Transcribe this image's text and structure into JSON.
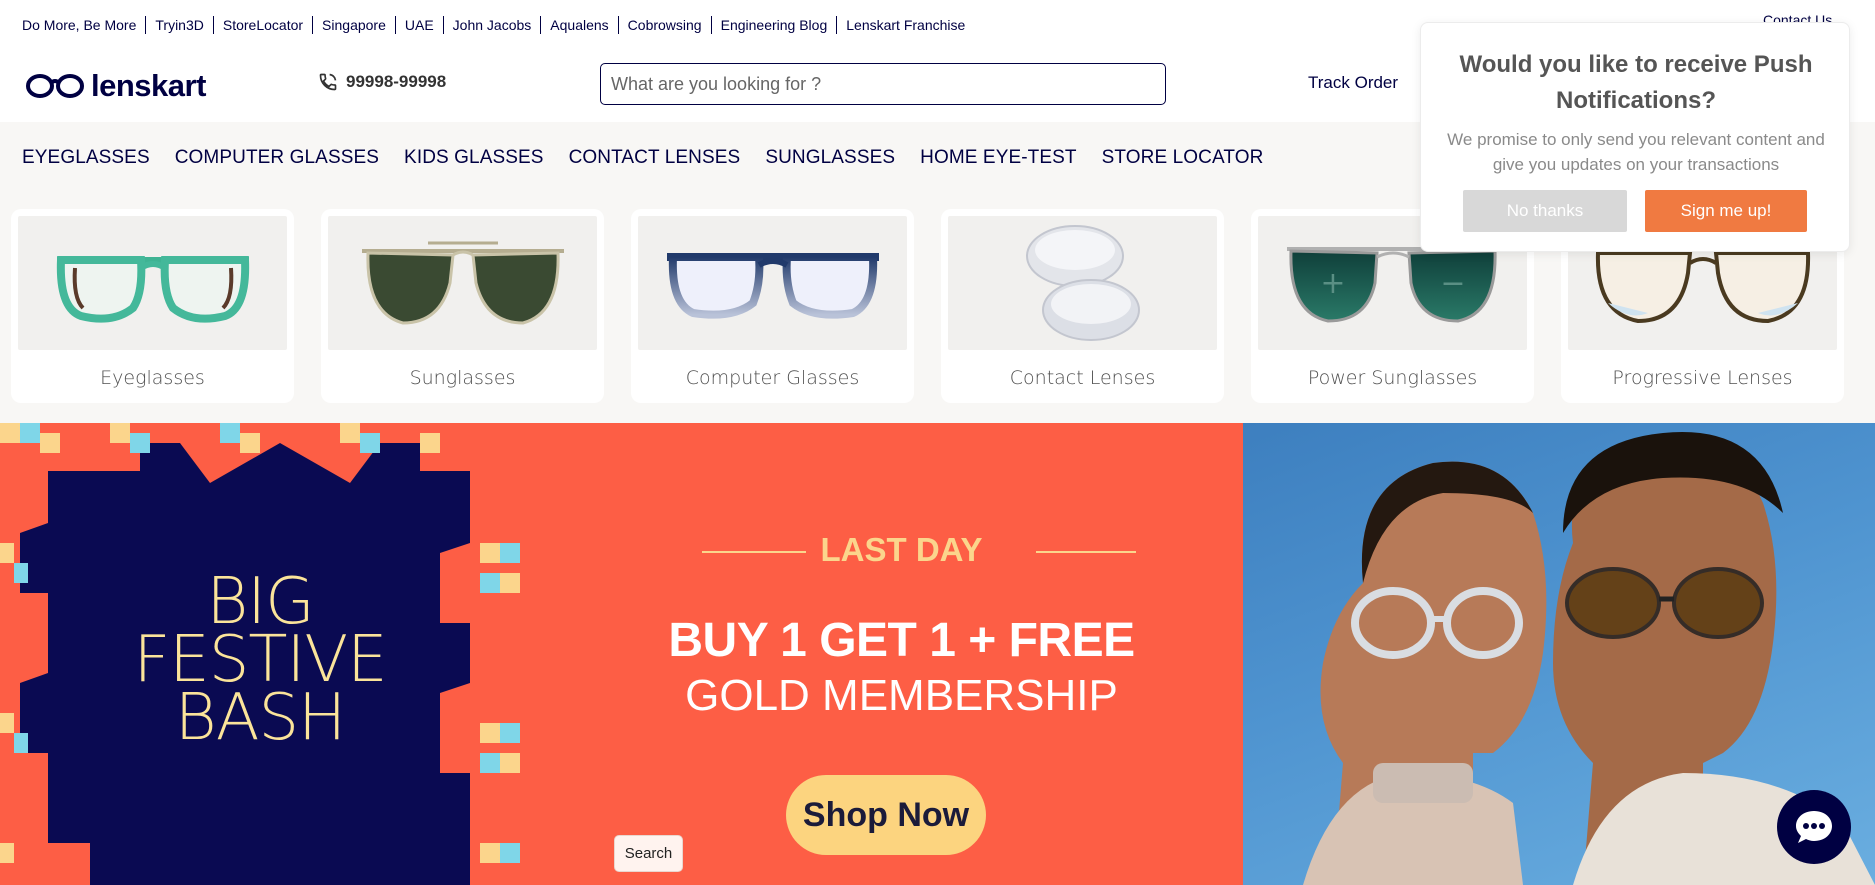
{
  "top_links": [
    "Do More, Be More",
    "Tryin3D",
    "StoreLocator",
    "Singapore",
    "UAE",
    "John Jacobs",
    "Aqualens",
    "Cobrowsing",
    "Engineering Blog",
    "Lenskart Franchise"
  ],
  "contact_us": "Contact Us",
  "logo_text": "lenskart",
  "phone": "99998-99998",
  "search": {
    "placeholder": "What are you looking for ?"
  },
  "track_order": "Track Order",
  "nav": [
    "EYEGLASSES",
    "COMPUTER GLASSES",
    "KIDS GLASSES",
    "CONTACT LENSES",
    "SUNGLASSES",
    "HOME EYE-TEST",
    "STORE LOCATOR"
  ],
  "categories": [
    {
      "label": "Eyeglasses",
      "icon": "eyeglasses-icon"
    },
    {
      "label": "Sunglasses",
      "icon": "sunglasses-icon"
    },
    {
      "label": "Computer Glasses",
      "icon": "computer-glasses-icon"
    },
    {
      "label": "Contact Lenses",
      "icon": "contact-lenses-icon"
    },
    {
      "label": "Power Sunglasses",
      "icon": "power-sunglasses-icon"
    },
    {
      "label": "Progressive Lenses",
      "icon": "progressive-lenses-icon"
    }
  ],
  "banner": {
    "title_line1": "BIG",
    "title_line2": "FESTIVE",
    "title_line3": "BASH",
    "last_day": "LAST DAY",
    "offer_line1": "BUY 1 GET 1 + FREE",
    "offer_line2": "GOLD MEMBERSHIP",
    "cta": "Shop Now"
  },
  "search_chip": "Search",
  "popup": {
    "title": "Would you like to receive Push Notifications?",
    "text": "We promise to only send you relevant content and give you updates on your transactions",
    "decline": "No thanks",
    "accept": "Sign me up!"
  },
  "colors": {
    "brand_navy": "#000042",
    "banner_orange": "#fd5e45",
    "banner_gold": "#fbd58c",
    "popup_accept": "#f07a41"
  }
}
